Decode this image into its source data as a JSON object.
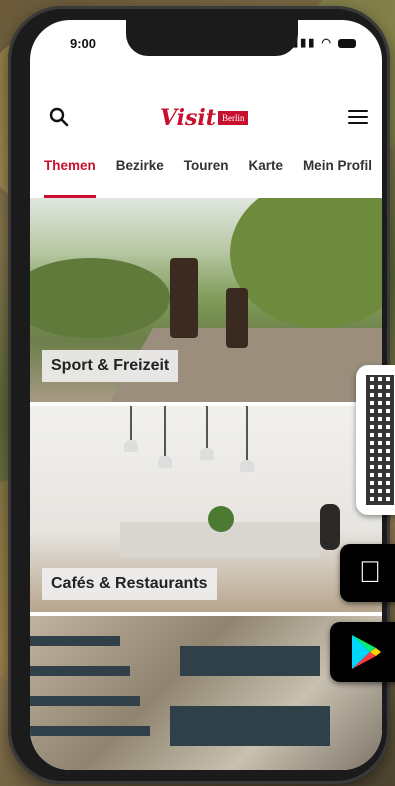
{
  "status": {
    "time": "9:00"
  },
  "logo": {
    "visit": "Visit",
    "city": "Berlin"
  },
  "tabs": [
    {
      "label": "Themen"
    },
    {
      "label": "Bezirke"
    },
    {
      "label": "Touren"
    },
    {
      "label": "Karte"
    },
    {
      "label": "Mein Profil"
    }
  ],
  "cards": [
    {
      "label": "Sport & Freizeit"
    },
    {
      "label": "Cafés & Restaurants"
    },
    {
      "label": ""
    }
  ],
  "icons": {
    "search": "search-icon",
    "menu": "hamburger-menu-icon",
    "qr": "qr-code-icon",
    "apple": "apple-icon",
    "google_play": "google-play-icon"
  },
  "colors": {
    "accent": "#c8102e"
  }
}
